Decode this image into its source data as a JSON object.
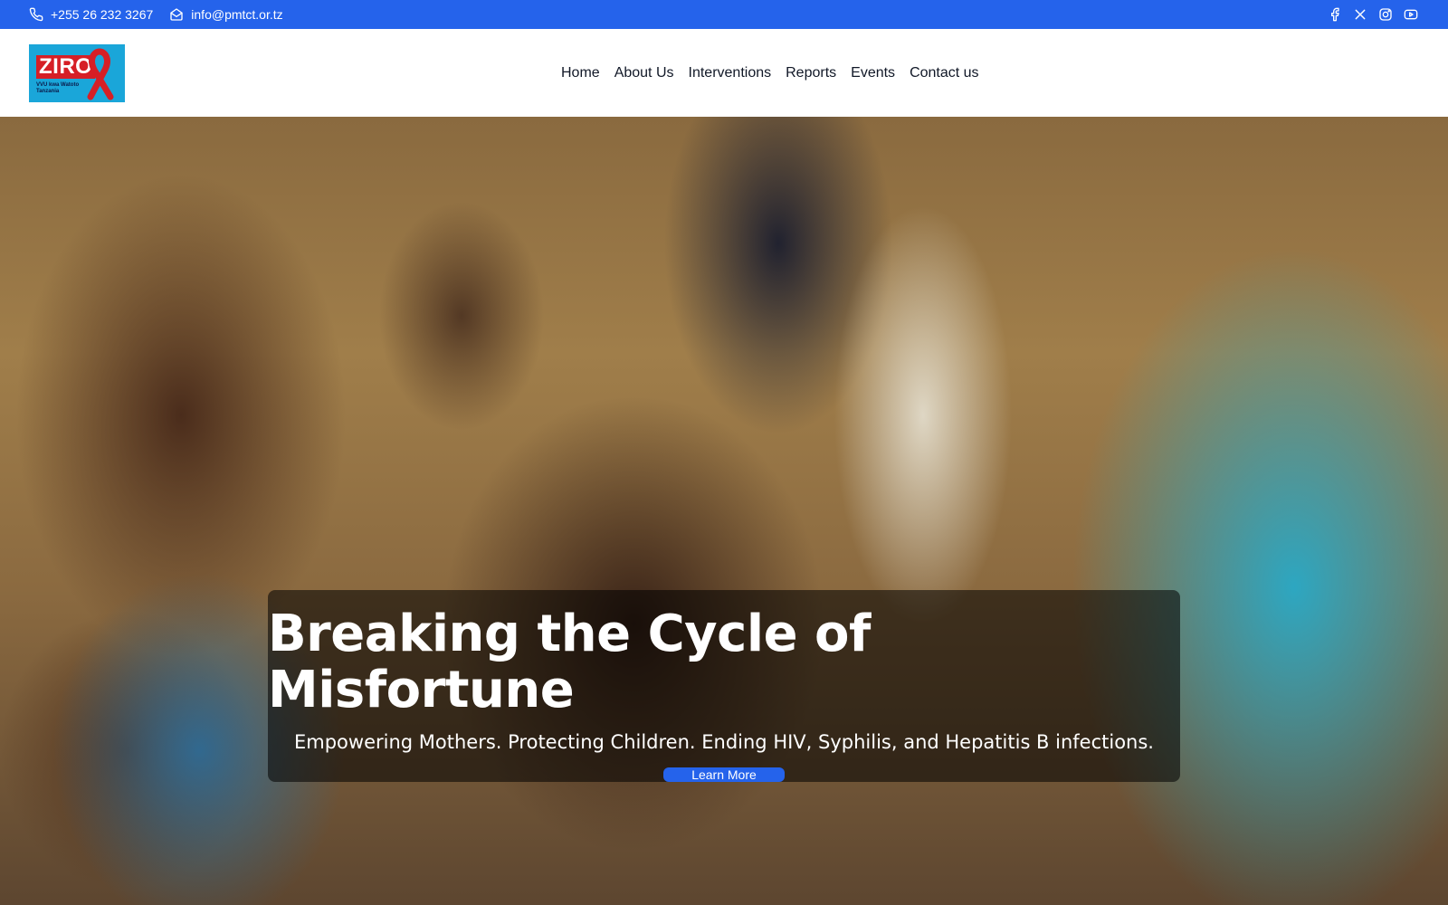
{
  "topbar": {
    "phone": "+255 26 232 3267",
    "email": "info@pmtct.or.tz",
    "social_icons": [
      "facebook-icon",
      "x-icon",
      "instagram-icon",
      "youtube-icon"
    ]
  },
  "logo": {
    "word": "ZIRO",
    "tagline": "VVU kwa Watoto Tanzania"
  },
  "nav": {
    "items": [
      {
        "label": "Home"
      },
      {
        "label": "About Us"
      },
      {
        "label": "Interventions"
      },
      {
        "label": "Reports"
      },
      {
        "label": "Events"
      },
      {
        "label": "Contact us"
      }
    ]
  },
  "hero": {
    "title": "Breaking the Cycle of Misfortune",
    "subtitle": "Empowering Mothers. Protecting Children. Ending HIV, Syphilis, and Hepatitis B infections.",
    "button_label": "Learn More"
  },
  "colors": {
    "accent": "#2563eb",
    "logo_bg": "#1aa6d9",
    "logo_red": "#d61f26"
  }
}
